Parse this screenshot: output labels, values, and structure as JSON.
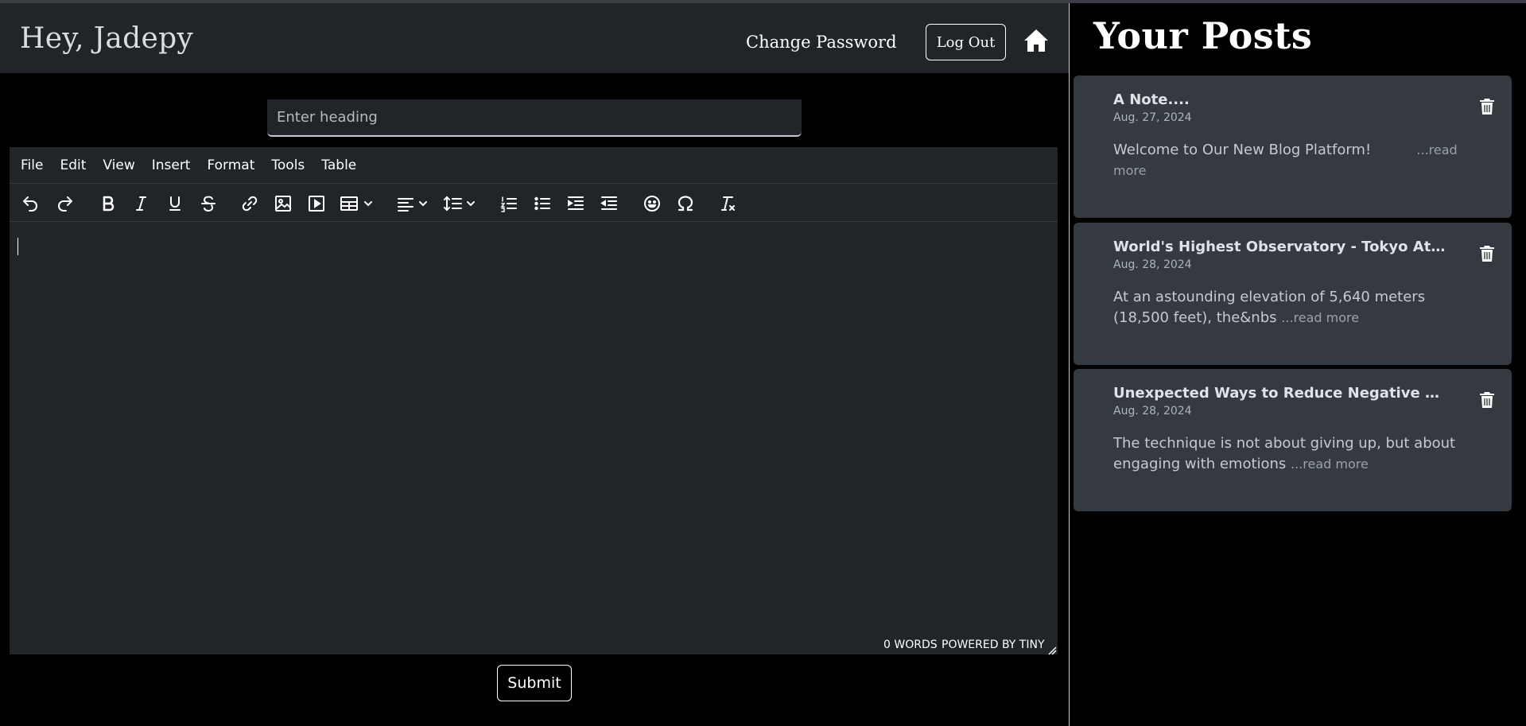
{
  "header": {
    "greeting": "Hey, Jadepy",
    "change_password": "Change Password",
    "logout": "Log Out",
    "home_icon": "home-icon"
  },
  "editor": {
    "heading_placeholder": "Enter heading",
    "menu": [
      "File",
      "Edit",
      "View",
      "Insert",
      "Format",
      "Tools",
      "Table"
    ],
    "toolbar_icons": [
      "undo-icon",
      "redo-icon",
      "bold-icon",
      "italic-icon",
      "underline-icon",
      "strikethrough-icon",
      "link-icon",
      "image-icon",
      "media-icon",
      "table-icon",
      "align-icon",
      "line-height-icon",
      "numbered-list-icon",
      "bullet-list-icon",
      "indent-icon",
      "outdent-icon",
      "emoji-icon",
      "special-char-icon",
      "clear-format-icon"
    ],
    "word_count": "0 WORDS",
    "powered_by": "POWERED BY TINY",
    "submit": "Submit"
  },
  "sidebar": {
    "title": "Your Posts",
    "read_more": "...read more",
    "posts": [
      {
        "title": "A Note....",
        "date": "Aug. 27, 2024",
        "excerpt": "Welcome to Our New Blog Platform!"
      },
      {
        "title": "World's Highest Observatory - Tokyo Atacama Observatory",
        "date": "Aug. 28, 2024",
        "excerpt": "At an astounding elevation of 5,640 meters (18,500 feet), the&nbs"
      },
      {
        "title": "Unexpected Ways to Reduce Negative Emotions",
        "date": "Aug. 28, 2024",
        "excerpt": "The technique is not about giving up, but about engaging with emotions"
      }
    ]
  },
  "colors": {
    "panel_bg": "#212529",
    "card_bg": "#343a40",
    "page_bg": "#000000"
  }
}
